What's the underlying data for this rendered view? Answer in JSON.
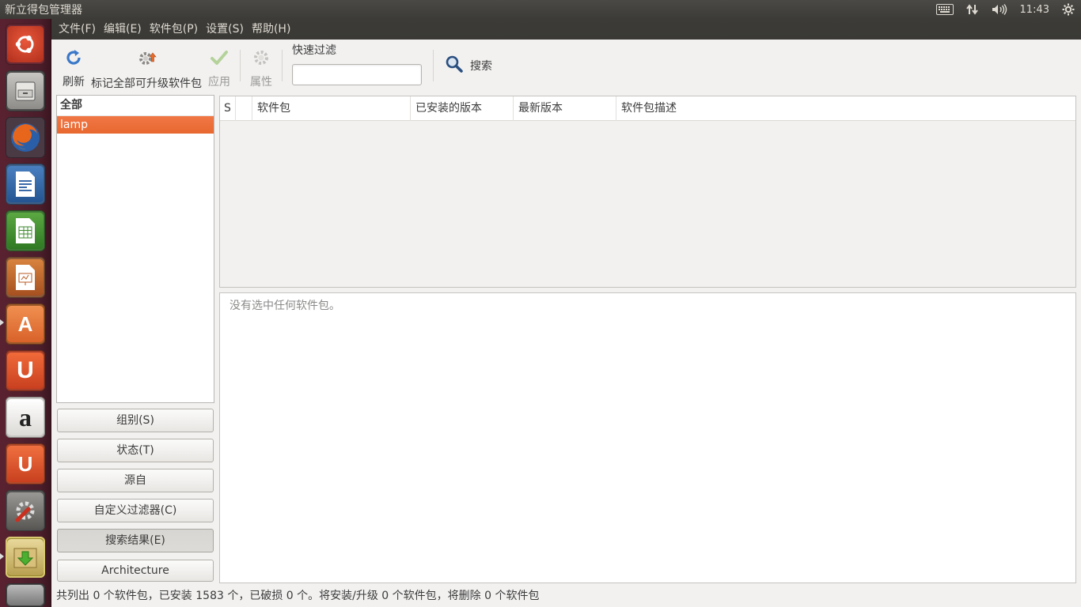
{
  "top_panel": {
    "app_title": "新立得包管理器",
    "clock": "11:43",
    "icons": [
      "keyboard-icon",
      "network-icon",
      "volume-icon",
      "settings-gear-icon"
    ]
  },
  "launcher": {
    "items": [
      "ubuntu-dash",
      "files",
      "firefox",
      "libreoffice-writer",
      "libreoffice-calc",
      "libreoffice-impress",
      "ubuntu-software-center",
      "ubuntu-one",
      "amazon",
      "ubuntu-one-music",
      "system-settings",
      "synaptic",
      "trash"
    ]
  },
  "menubar": {
    "items": [
      "文件(F)",
      "编辑(E)",
      "软件包(P)",
      "设置(S)",
      "帮助(H)"
    ]
  },
  "toolbar": {
    "refresh_label": "刷新",
    "mark_all_label": "标记全部可升级软件包",
    "apply_label": "应用",
    "properties_label": "属性",
    "quick_filter_label": "快速过滤",
    "quick_filter_value": "",
    "search_label": "搜索"
  },
  "left_panel": {
    "header": "全部",
    "rows": [
      "lamp"
    ],
    "buttons": {
      "sections": "组别(S)",
      "status": "状态(T)",
      "origin": "源自",
      "custom": "自定义过滤器(C)",
      "search_results": "搜索结果(E)",
      "architecture": "Architecture"
    }
  },
  "package_table": {
    "columns": [
      "S",
      "",
      "软件包",
      "已安装的版本",
      "最新版本",
      "软件包描述"
    ]
  },
  "details": {
    "text": "没有选中任何软件包。"
  },
  "statusbar": {
    "text": "共列出 0 个软件包，已安装 1583 个，已破损 0 个。将安装/升级 0 个软件包，将删除 0 个软件包"
  }
}
